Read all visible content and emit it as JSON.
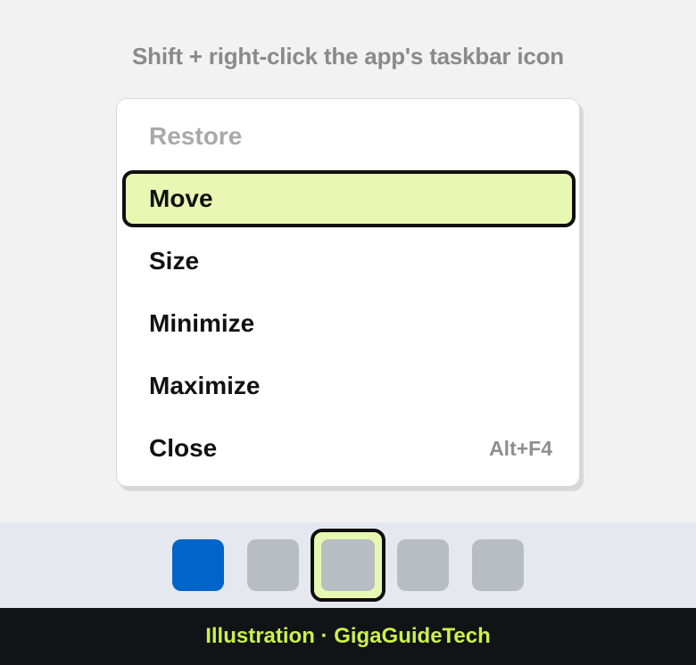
{
  "instruction": "Shift + right-click the app's taskbar icon",
  "menu": {
    "items": [
      {
        "label": "Restore",
        "shortcut": "",
        "state": "disabled"
      },
      {
        "label": "Move",
        "shortcut": "",
        "state": "selected"
      },
      {
        "label": "Size",
        "shortcut": "",
        "state": "normal"
      },
      {
        "label": "Minimize",
        "shortcut": "",
        "state": "normal"
      },
      {
        "label": "Maximize",
        "shortcut": "",
        "state": "normal"
      },
      {
        "label": "Close",
        "shortcut": "Alt+F4",
        "state": "normal"
      }
    ]
  },
  "taskbar": {
    "icons": [
      {
        "name": "start-icon",
        "color": "#0064c8"
      },
      {
        "name": "app-icon",
        "color": "#b8bcc3"
      },
      {
        "name": "target-app-icon",
        "color": "#b8bcc3",
        "highlighted": true
      },
      {
        "name": "app-icon",
        "color": "#b8bcc3"
      },
      {
        "name": "app-icon",
        "color": "#b8bcc3"
      }
    ]
  },
  "footer": {
    "credit": "Illustration · GigaGuideTech"
  },
  "colors": {
    "highlight": "#e8f8b2",
    "accent_text": "#cdf04a",
    "start": "#0064c8"
  }
}
